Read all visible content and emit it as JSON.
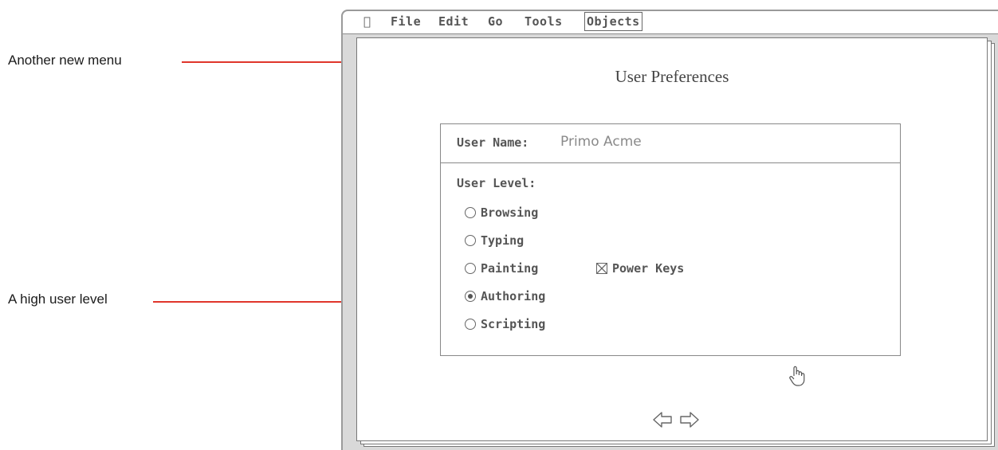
{
  "callouts": {
    "menu_note": "Another new menu",
    "level_note": "A high user level"
  },
  "menubar": {
    "apple_icon": "apple-icon",
    "items": [
      "File",
      "Edit",
      "Go",
      "Tools",
      "Objects"
    ]
  },
  "card": {
    "title": "User Preferences"
  },
  "prefs": {
    "user_name_label": "User Name:",
    "user_name_value": "Primo Acme",
    "user_level_label": "User Level:",
    "levels": [
      {
        "label": "Browsing",
        "selected": false
      },
      {
        "label": "Typing",
        "selected": false
      },
      {
        "label": "Painting",
        "selected": false
      },
      {
        "label": "Authoring",
        "selected": true
      },
      {
        "label": "Scripting",
        "selected": false
      }
    ],
    "power_keys_label": "Power Keys",
    "power_keys_checked": true
  },
  "icons": {
    "cursor": "browse-hand-icon",
    "prev": "left-arrow-icon",
    "next": "right-arrow-icon"
  },
  "colors": {
    "leader_line": "#e0352b"
  }
}
